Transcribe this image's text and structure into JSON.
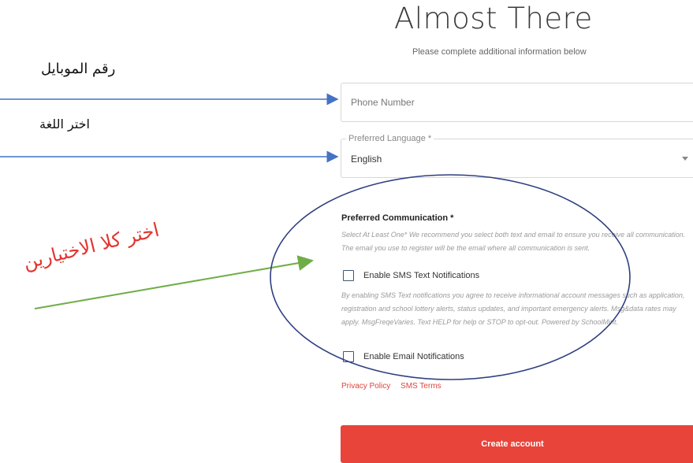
{
  "page": {
    "title": "Almost There",
    "subtitle": "Please complete additional information below"
  },
  "phone": {
    "placeholder": "Phone Number"
  },
  "language": {
    "legend": "Preferred Language *",
    "value": "English"
  },
  "communication": {
    "label": "Preferred Communication *",
    "help": "Select At Least One* We recommend you select both text and email to ensure you receive all communication. The email you use to register will be the email where all communication is sent.",
    "sms_label": "Enable SMS Text Notifications",
    "sms_checked": false,
    "disclaimer": "By enabling SMS Text notifications you agree to receive informational account messages such as application, registration and school lottery alerts, status updates, and important emergency alerts. Msg&data rates may apply. MsgFreqeVaries. Text HELP for help or STOP to opt-out. Powered by SchoolMint.",
    "email_label": "Enable Email Notifications",
    "email_checked": false
  },
  "links": {
    "privacy": "Privacy Policy",
    "sms_terms": "SMS Terms"
  },
  "actions": {
    "create": "Create account"
  },
  "annotations": {
    "mobile_label": "رقم الموبايل",
    "language_label": "اختر اللغة",
    "choose_both": "اختر كلا الاختيارين",
    "arrow_color": "#4472c4",
    "highlight_arrow_color": "#70ad47",
    "ellipse_color": "#2f3f7f",
    "text_highlight_color": "#e3342f"
  }
}
